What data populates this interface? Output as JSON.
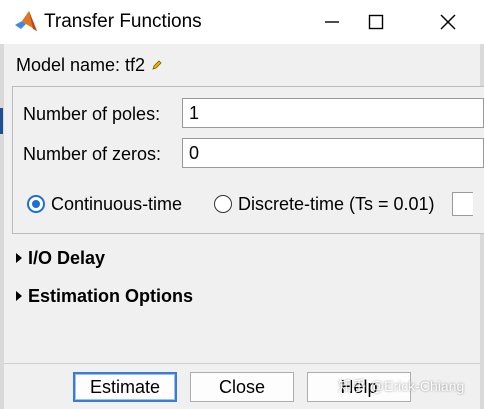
{
  "window": {
    "title": "Transfer Functions",
    "controls": [
      "minimize-icon",
      "maximize-icon",
      "close-icon"
    ],
    "icon": "matlab-logo-icon"
  },
  "model": {
    "label": "Model name: tf2",
    "edit_icon": "pencil-icon"
  },
  "params": {
    "poles_label": "Number of poles:",
    "poles_value": "1",
    "zeros_label": "Number of zeros:",
    "zeros_value": "0"
  },
  "time_domain": {
    "continuous_label": "Continuous-time",
    "continuous_selected": true,
    "discrete_label": "Discrete-time (Ts = 0.01)",
    "discrete_selected": false
  },
  "sections": [
    {
      "label": "I/O Delay",
      "expanded": false
    },
    {
      "label": "Estimation Options",
      "expanded": false
    }
  ],
  "buttons": {
    "estimate": "Estimate",
    "close": "Close",
    "help": "Help"
  },
  "watermark": "知乎 @Erick-Chiang",
  "colors": {
    "accent": "#1a6ee0",
    "background": "#f0f0f0"
  }
}
